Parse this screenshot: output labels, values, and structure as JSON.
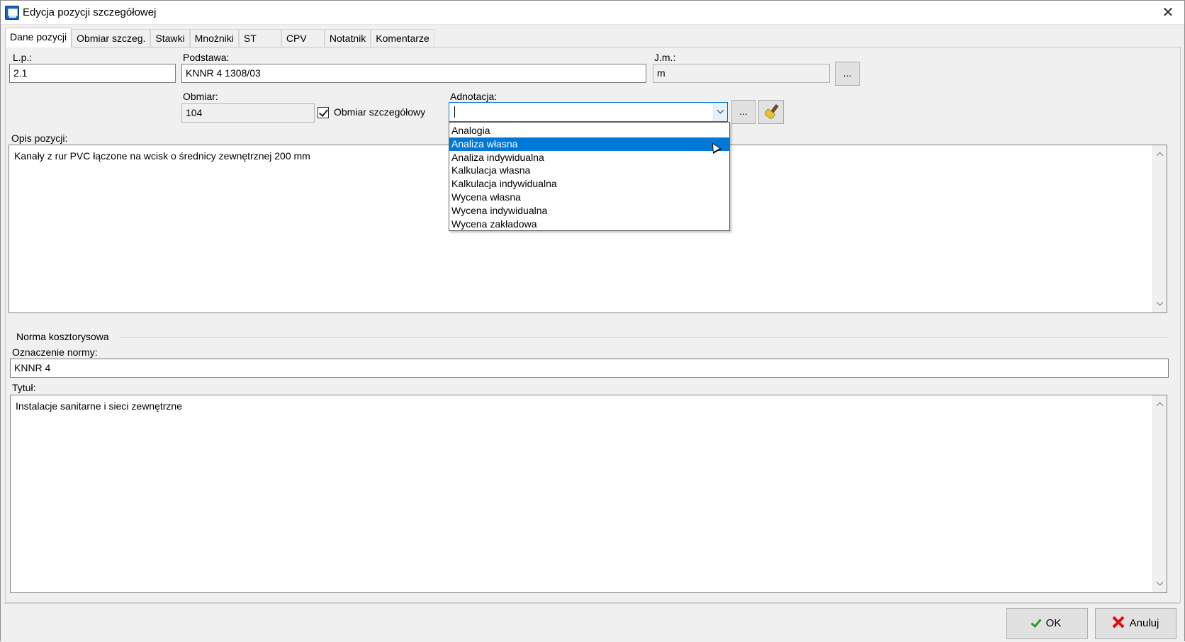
{
  "window": {
    "title": "Edycja pozycji szczegółowej"
  },
  "tabs": [
    {
      "label": "Dane pozycji"
    },
    {
      "label": "Obmiar szczeg."
    },
    {
      "label": "Stawki"
    },
    {
      "label": "Mnożniki"
    },
    {
      "label": "ST"
    },
    {
      "label": "CPV"
    },
    {
      "label": "Notatnik"
    },
    {
      "label": "Komentarze"
    }
  ],
  "form": {
    "lp_label": "L.p.:",
    "lp_value": "2.1",
    "podstawa_label": "Podstawa:",
    "podstawa_value": "KNNR 4 1308/03",
    "jm_label": "J.m.:",
    "jm_value": "m",
    "jm_button": "...",
    "obmiar_label": "Obmiar:",
    "obmiar_value": "104",
    "obmiar_szczegolowy_label": "Obmiar szczegółowy",
    "obmiar_szczegolowy_checked": true,
    "adnotacja_label": "Adnotacja:",
    "adnotacja_value": "",
    "adnotacja_button": "...",
    "opis_label": "Opis pozycji:",
    "opis_value": "Kanały z rur PVC łączone na wcisk o średnicy zewnętrznej 200 mm"
  },
  "adnotacja_options": [
    "Analogia",
    "Analiza własna",
    "Analiza indywidualna",
    "Kalkulacja własna",
    "Kalkulacja indywidualna",
    "Wycena własna",
    "Wycena indywidualna",
    "Wycena zakładowa"
  ],
  "adnotacja_highlighted_index": 1,
  "norma": {
    "group_title": "Norma kosztorysowa",
    "oznaczenie_label": "Oznaczenie normy:",
    "oznaczenie_value": "KNNR 4",
    "tytul_label": "Tytuł:",
    "tytul_value": "Instalacje sanitarne i sieci zewnętrzne"
  },
  "footer": {
    "ok_label": "OK",
    "cancel_label": "Anuluj"
  },
  "colors": {
    "selection": "#0078d7",
    "ok_icon": "#2e9a2e",
    "cancel_icon": "#dd1111"
  },
  "icons": {
    "app": "app-icon",
    "close": "close-icon",
    "brush": "brush-icon",
    "ok": "check-icon",
    "cancel": "x-icon"
  }
}
